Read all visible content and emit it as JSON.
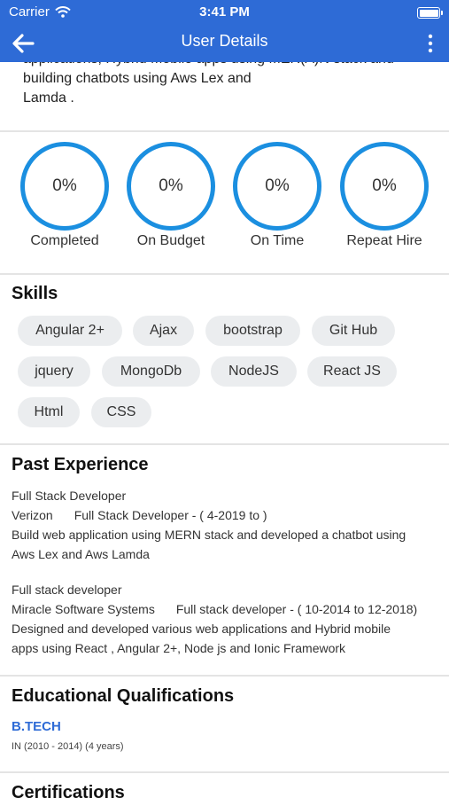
{
  "status_bar": {
    "carrier": "Carrier",
    "time": "3:41 PM"
  },
  "nav": {
    "title": "User Details",
    "back_icon": "arrow-left-icon",
    "menu_icon": "more-vertical-icon"
  },
  "about": {
    "line1": "applications, Hybrid Mobile apps using MER(A)N stack and",
    "line2": "building chatbots using Aws Lex and",
    "line3": "Lamda ."
  },
  "stats": [
    {
      "value": "0%",
      "label": "Completed"
    },
    {
      "value": "0%",
      "label": "On Budget"
    },
    {
      "value": "0%",
      "label": "On Time"
    },
    {
      "value": "0%",
      "label": "Repeat Hire"
    }
  ],
  "skills": {
    "title": "Skills",
    "items": [
      "Angular 2+",
      "Ajax",
      "bootstrap",
      "Git Hub",
      "jquery",
      "MongoDb",
      "NodeJS",
      "React JS",
      "Html",
      "CSS"
    ]
  },
  "experience": {
    "title": "Past Experience",
    "items": [
      {
        "title": "Full Stack Developer",
        "company": "Verizon",
        "role_period": "Full Stack Developer - ( 4-2019 to )",
        "description_line1": "Build web application using MERN stack and developed a chatbot using",
        "description_line2": "Aws Lex and Aws Lamda"
      },
      {
        "title": "Full stack developer",
        "company": "Miracle Software Systems",
        "role_period": "Full stack developer - ( 10-2014 to 12-2018)",
        "description_line1": "Designed and developed various web applications and Hybrid mobile",
        "description_line2": "apps using React , Angular 2+, Node js and Ionic Framework"
      }
    ]
  },
  "education": {
    "title": "Educational Qualifications",
    "degree": "B.TECH",
    "detail": "IN (2010 - 2014) (4 years)"
  },
  "certifications": {
    "title": "Certifications"
  },
  "colors": {
    "header": "#2e6bd6",
    "ring": "#1b8fe0",
    "chip": "#ebedef",
    "link": "#2e6bd6"
  }
}
